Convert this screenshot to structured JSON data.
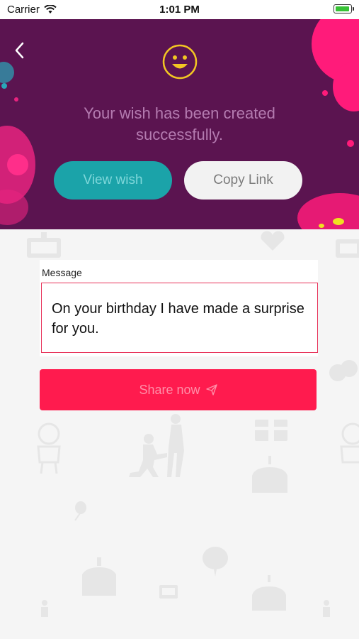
{
  "status_bar": {
    "carrier": "Carrier",
    "time": "1:01 PM"
  },
  "header": {
    "message": "Your wish has been created successfully.",
    "view_button": "View wish",
    "copy_button": "Copy Link"
  },
  "form": {
    "message_label": "Message",
    "message_value": "On your birthday I have made a surprise for you.",
    "share_label": "Share now"
  },
  "colors": {
    "header_bg": "#5b1450",
    "accent_pink": "#ff1b4e",
    "teal": "#1ba3a9",
    "smiley_yellow": "#f2c623"
  },
  "icons": [
    "back-chevron-icon",
    "smiley-icon",
    "send-icon",
    "wifi-icon",
    "battery-icon"
  ]
}
